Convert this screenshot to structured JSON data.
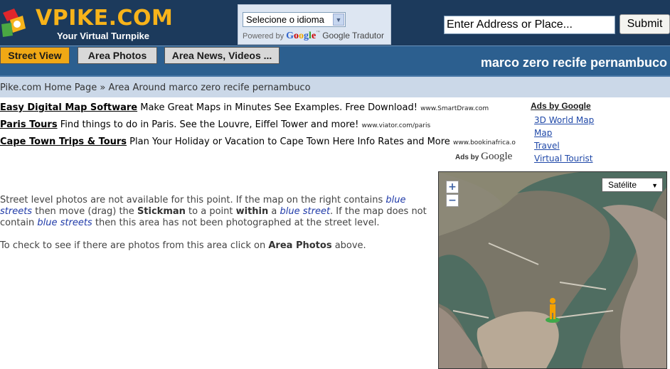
{
  "header": {
    "logo_text": "VPIKE.COM",
    "logo_sub": "Your Virtual Turnpike",
    "translate": {
      "selected_language": "Selecione o idioma",
      "powered_by": "Powered by",
      "google": "Google",
      "tm": "™",
      "tradutor": "Google Tradutor"
    },
    "address_input": {
      "value": "Enter Address or Place..."
    },
    "submit_label": "Submit"
  },
  "tabs": [
    {
      "label": "Street View",
      "active": true
    },
    {
      "label": "Area Photos",
      "active": false
    },
    {
      "label": "Area News, Videos ...",
      "active": false
    }
  ],
  "page_title": "marco zero recife pernambuco",
  "breadcrumb": "Pike.com Home Page » Area Around marco zero recife pernambuco",
  "ads": [
    {
      "title": "Easy Digital Map Software",
      "text": " Make Great Maps in Minutes See Examples. Free Download! ",
      "url": "www.SmartDraw.com"
    },
    {
      "title": "Paris Tours",
      "text": " Find things to do in Paris. See the Louvre, Eiffel Tower and more! ",
      "url": "www.viator.com/paris"
    },
    {
      "title": "Cape Town Trips & Tours",
      "text": " Plan Your Holiday or Vacation to Cape Town Here Info Rates and More ",
      "url": "www.bookinafrica.o"
    }
  ],
  "ads_by_google_small": {
    "prefix": "Ads by",
    "google": "Google"
  },
  "side_ads": {
    "title": "Ads by Google",
    "links": [
      "3D World Map",
      "Map",
      "Travel",
      "Virtual Tourist"
    ]
  },
  "info": {
    "p1_a": "Street level photos are not available for this point. If the map on the right contains ",
    "blue_streets": "blue streets",
    "p1_b": " then move (drag) the ",
    "stickman": "Stickman",
    "p1_c": " to a point ",
    "within": "within",
    "p1_d": " a ",
    "blue_street": "blue street",
    "p1_e": ". If the map does not contain ",
    "p1_f": " then this area has not been photographed at the street level.",
    "p2_a": "To check to see if there are photos from this area click on ",
    "area_photos": "Area Photos",
    "p2_b": " above."
  },
  "map": {
    "type_selected": "Satélite",
    "zoom_in": "+",
    "zoom_out": "−"
  },
  "colors": {
    "header_bg": "#1c3a5c",
    "logo_orange": "#f7b31a",
    "tab_active": "#f0a815",
    "link_blue": "#1f48a8"
  }
}
